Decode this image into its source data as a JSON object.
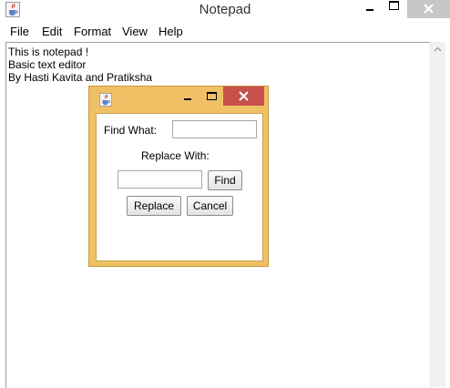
{
  "window": {
    "title": "Notepad",
    "icon": "java-cup-icon"
  },
  "menu": {
    "items": [
      "File",
      "Edit",
      "Format",
      "View",
      "Help"
    ]
  },
  "editor": {
    "lines": [
      "This is notepad !",
      "Basic text editor",
      "By Hasti Kavita and Pratiksha"
    ]
  },
  "dialog": {
    "icon": "java-cup-icon",
    "find_label": "Find What:",
    "find_value": "",
    "replace_label": "Replace With:",
    "replace_value": "",
    "find_button": "Find",
    "replace_button": "Replace",
    "cancel_button": "Cancel"
  },
  "colors": {
    "dialog_frame": "#f0c164",
    "dialog_close": "#c7504b",
    "window_close": "#c7c7c7"
  }
}
